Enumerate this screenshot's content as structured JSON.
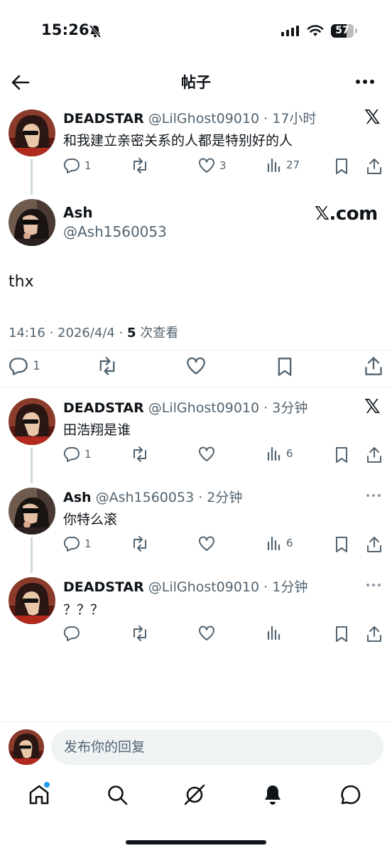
{
  "status_bar": {
    "time": "15:26",
    "battery": "57"
  },
  "header": {
    "title": "帖子"
  },
  "brand": {
    "x_logo": "𝕏",
    "xcom": "𝕏.com"
  },
  "posts": [
    {
      "name": "DEADSTAR",
      "handle": "@LilGhost09010",
      "time": "17小时",
      "text": "和我建立亲密关系的人都是特别好的人",
      "replies": "1",
      "likes": "3",
      "views": "27"
    },
    {
      "name": "DEADSTAR",
      "handle": "@LilGhost09010",
      "time": "3分钟",
      "text": "田浩翔是谁",
      "replies": "1",
      "views": "6"
    },
    {
      "name": "Ash",
      "handle": "@Ash1560053",
      "time": "2分钟",
      "text": "你特么滚",
      "replies": "1",
      "views": "6"
    },
    {
      "name": "DEADSTAR",
      "handle": "@LilGhost09010",
      "time": "1分钟",
      "text": "？？？"
    }
  ],
  "main_post": {
    "name": "Ash",
    "handle": "@Ash1560053",
    "text": "thx",
    "datetime": "14:16 · 2026/4/4 · ",
    "views_count": "5",
    "views_label": " 次查看",
    "replies": "1"
  },
  "reply_bar": {
    "placeholder": "发布你的回复"
  },
  "colors": {
    "accent": "#1d9bf0",
    "text": "#0f1419",
    "secondary": "#536471",
    "divider": "#eff3f4"
  }
}
